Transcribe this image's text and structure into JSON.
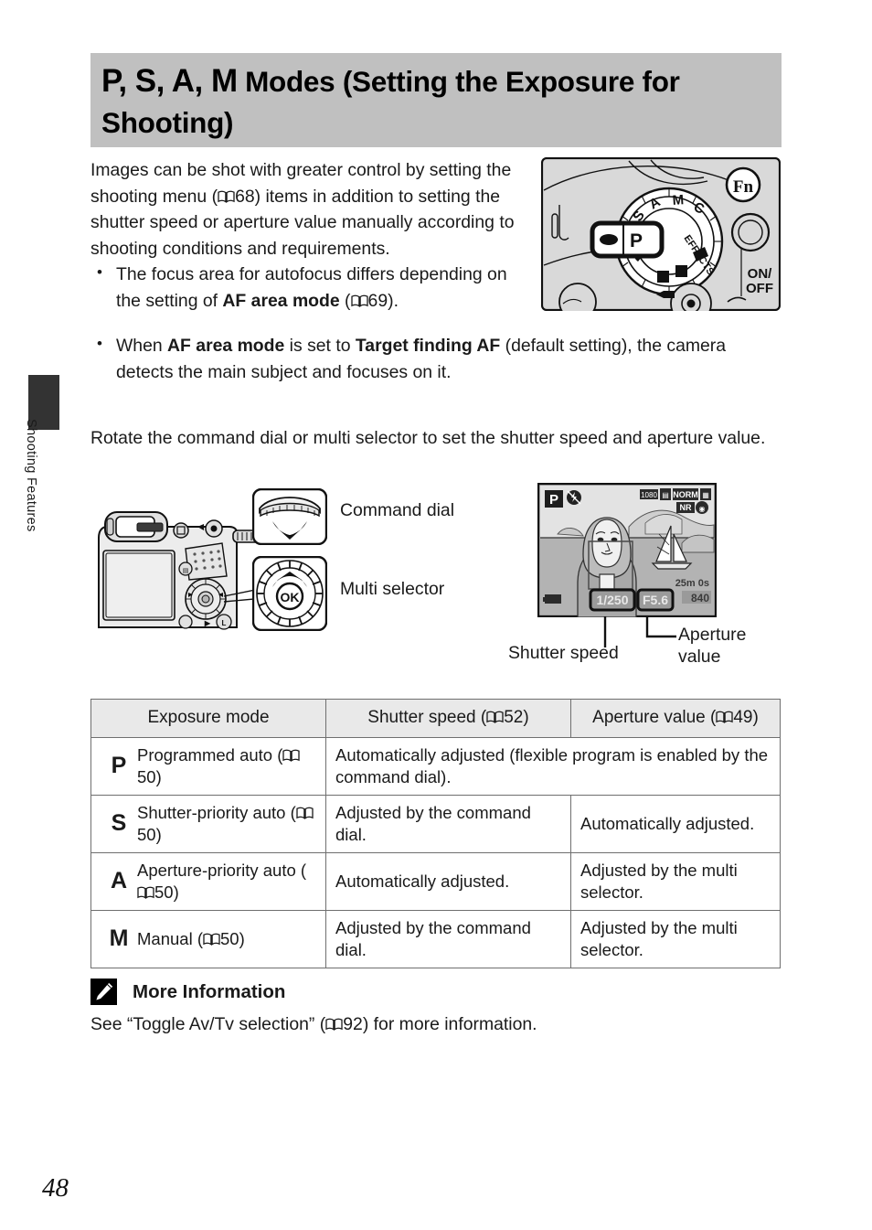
{
  "page": {
    "number": "48",
    "side_tab_label": "Shooting Features"
  },
  "header": {
    "mode_letters": "P, S, A, M",
    "title_rest": "Modes (Setting the Exposure for Shooting)",
    "band_color": "#c0c0c0"
  },
  "intro": {
    "paragraph_1_a": "Images can be shot with greater control by setting the shooting menu (",
    "paragraph_1_ref": "68",
    "paragraph_1_b": ") items in addition to setting the shutter speed or aperture value manually according to shooting conditions and requirements.",
    "bullets": [
      {
        "text_a": "The focus area for autofocus differs depending on the setting of ",
        "bold_1": "AF area mode",
        "text_b": " (",
        "ref": "69",
        "text_c": ")."
      },
      {
        "text_a": "When ",
        "bold_1": "AF area mode",
        "text_b": " is set to ",
        "bold_2": "Target finding AF",
        "text_c": " (default setting), the camera detects the main subject and focuses on it."
      }
    ],
    "rotate_paragraph": "Rotate the command dial or multi selector to set the shutter speed and aperture value."
  },
  "camera_top": {
    "fn_button_label": "Fn",
    "power_label_line1": "ON/",
    "power_label_line2": "OFF",
    "dial_modes": [
      "S",
      "A",
      "M",
      "C",
      "EFFECTS",
      "SCENE"
    ],
    "highlighted_mode": "P",
    "movie_icon": "movie-record-icon"
  },
  "callouts": {
    "command_dial": "Command dial",
    "multi_selector": "Multi selector",
    "ok_button": "OK"
  },
  "lcd": {
    "mode_badge": "P",
    "flash_icon": "flash-off-icon",
    "status_icons": [
      "1080",
      "NORM",
      "NR"
    ],
    "record_time": "25m 0s",
    "shots_remaining": "840",
    "shutter_speed_value": "1/250",
    "aperture_value": "F5.6",
    "battery_icon": "battery-icon",
    "label_shutter_speed": "Shutter speed",
    "label_aperture_value_line1": "Aperture",
    "label_aperture_value_line2": "value"
  },
  "table": {
    "headers": {
      "exposure_mode": "Exposure mode",
      "shutter_speed_a": "Shutter speed (",
      "shutter_speed_ref": "52",
      "shutter_speed_b": ")",
      "aperture_value_a": "Aperture value (",
      "aperture_value_ref": "49",
      "aperture_value_b": ")"
    },
    "rows": [
      {
        "letter": "P",
        "name_a": "Programmed auto (",
        "name_ref": "50",
        "name_b": ")",
        "shutter": "Automatically adjusted (flexible program is enabled by the command dial).",
        "aperture": null,
        "span": true
      },
      {
        "letter": "S",
        "name_a": "Shutter-priority auto (",
        "name_ref": "50",
        "name_b": ")",
        "shutter": "Adjusted by the command dial.",
        "aperture": "Automatically adjusted.",
        "span": false
      },
      {
        "letter": "A",
        "name_a": "Aperture-priority auto (",
        "name_ref": "50",
        "name_b": ")",
        "shutter": "Automatically adjusted.",
        "aperture": "Adjusted by the multi selector.",
        "span": false
      },
      {
        "letter": "M",
        "name_a": "Manual (",
        "name_ref": "50",
        "name_b": ")",
        "shutter": "Adjusted by the command dial.",
        "aperture": "Adjusted by the multi selector.",
        "span": false
      }
    ]
  },
  "more_information": {
    "icon": "pencil-icon",
    "title": "More Information",
    "body_a": "See “Toggle Av/Tv selection” (",
    "body_ref": "92",
    "body_b": ") for more information."
  }
}
